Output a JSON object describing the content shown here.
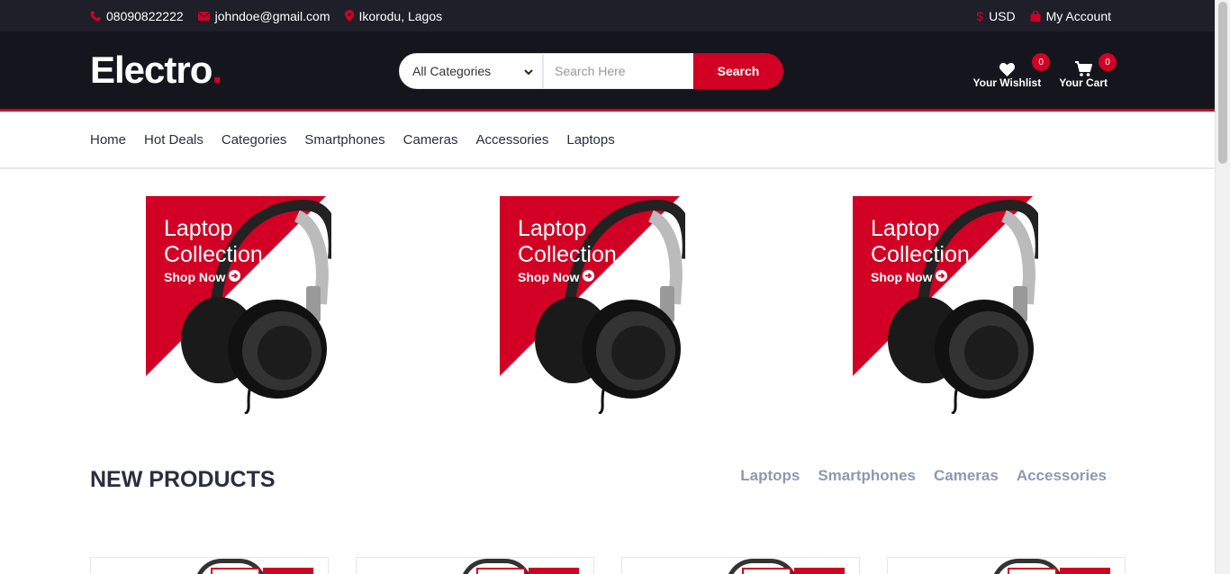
{
  "topbar": {
    "phone": "08090822222",
    "email": "johndoe@gmail.com",
    "location": "Ikorodu, Lagos",
    "currency": "USD",
    "account": "My Account"
  },
  "header": {
    "logo_text": "Electro",
    "logo_dot": ".",
    "category_selected": "All Categories",
    "search_placeholder": "Search Here",
    "search_button": "Search",
    "wishlist_label": "Your Wishlist",
    "wishlist_count": "0",
    "cart_label": "Your Cart",
    "cart_count": "0"
  },
  "nav": {
    "items": [
      "Home",
      "Hot Deals",
      "Categories",
      "Smartphones",
      "Cameras",
      "Accessories",
      "Laptops"
    ]
  },
  "banners": [
    {
      "title_line1": "Laptop",
      "title_line2": "Collection",
      "cta": "Shop Now"
    },
    {
      "title_line1": "Laptop",
      "title_line2": "Collection",
      "cta": "Shop Now"
    },
    {
      "title_line1": "Laptop",
      "title_line2": "Collection",
      "cta": "Shop Now"
    }
  ],
  "new_products": {
    "title": "NEW PRODUCTS",
    "tabs": [
      "Laptops",
      "Smartphones",
      "Cameras",
      "Accessories"
    ]
  },
  "colors": {
    "accent": "#D10024",
    "dark_header": "#15161D",
    "topbar": "#1E1F29",
    "tab_text": "#8D99AE"
  }
}
